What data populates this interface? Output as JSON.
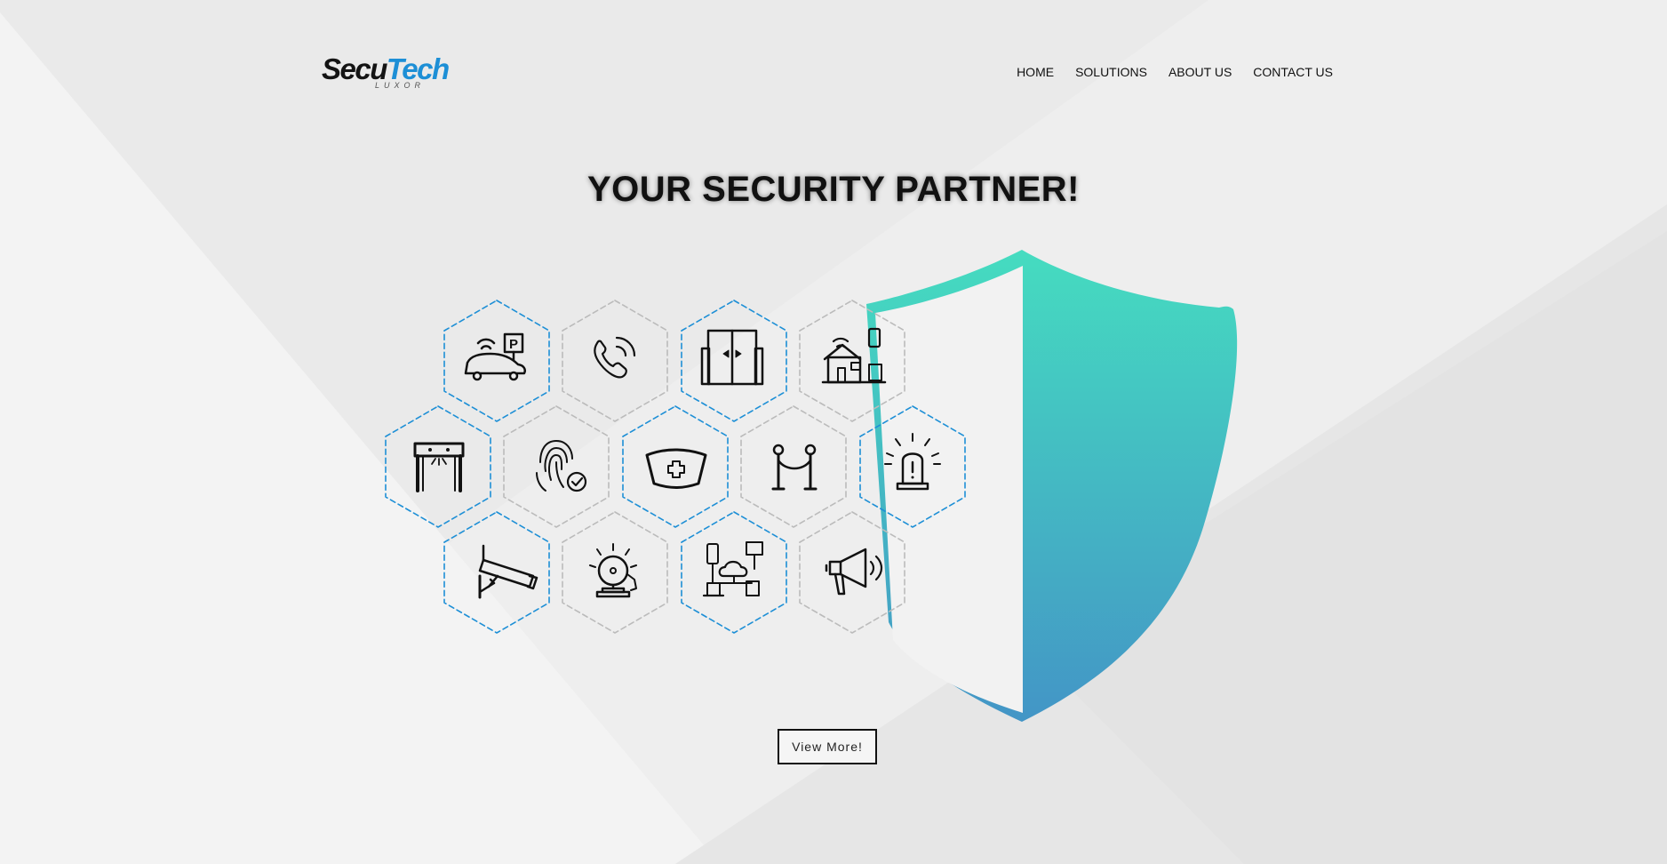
{
  "brand": {
    "name_part1": "Secu",
    "name_part2": "Tech",
    "tagline": "LUXOR",
    "accent_color": "#1d8fd6"
  },
  "nav": {
    "items": [
      {
        "label": "HOME"
      },
      {
        "label": "SOLUTIONS"
      },
      {
        "label": "ABOUT US"
      },
      {
        "label": "CONTACT US"
      }
    ]
  },
  "hero": {
    "title": "YOUR SECURITY PARTNER!",
    "button_label": "View More!"
  },
  "shield": {
    "gradient_top": "#45dcc0",
    "gradient_bottom": "#4395c6"
  },
  "tiles": [
    {
      "icon": "car-parking-icon",
      "border": "blue"
    },
    {
      "icon": "phone-call-icon",
      "border": "gray"
    },
    {
      "icon": "automatic-door-icon",
      "border": "blue"
    },
    {
      "icon": "smart-home-icon",
      "border": "gray"
    },
    {
      "icon": "metal-detector-gate-icon",
      "border": "blue"
    },
    {
      "icon": "fingerprint-check-icon",
      "border": "gray"
    },
    {
      "icon": "nurse-cap-icon",
      "border": "blue"
    },
    {
      "icon": "rope-barrier-icon",
      "border": "gray"
    },
    {
      "icon": "alarm-siren-icon",
      "border": "blue"
    },
    {
      "icon": "security-camera-icon",
      "border": "blue"
    },
    {
      "icon": "fire-bell-icon",
      "border": "gray"
    },
    {
      "icon": "cloud-network-icon",
      "border": "blue"
    },
    {
      "icon": "megaphone-icon",
      "border": "gray"
    }
  ]
}
